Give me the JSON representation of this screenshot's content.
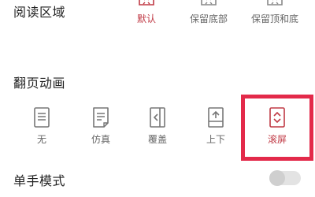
{
  "reading_area": {
    "title": "阅读区域",
    "options": [
      {
        "label": "默认",
        "selected": true,
        "icon": "area-default-icon"
      },
      {
        "label": "保留底部",
        "selected": false,
        "icon": "area-keep-bottom-icon"
      },
      {
        "label": "保留顶和底",
        "selected": false,
        "icon": "area-keep-top-bottom-icon"
      }
    ]
  },
  "page_animation": {
    "title": "翻页动画",
    "options": [
      {
        "label": "无",
        "selected": false,
        "icon": "no-animation-icon"
      },
      {
        "label": "仿真",
        "selected": false,
        "icon": "simulation-page-icon"
      },
      {
        "label": "覆盖",
        "selected": false,
        "icon": "cover-page-icon"
      },
      {
        "label": "上下",
        "selected": false,
        "icon": "up-down-icon"
      },
      {
        "label": "滚屏",
        "selected": true,
        "icon": "scroll-screen-icon"
      }
    ]
  },
  "one_hand_mode": {
    "title": "单手模式",
    "enabled": false
  },
  "colors": {
    "accent": "#c03a45",
    "highlight_border": "#e32a4a",
    "icon_gray": "#777777"
  }
}
